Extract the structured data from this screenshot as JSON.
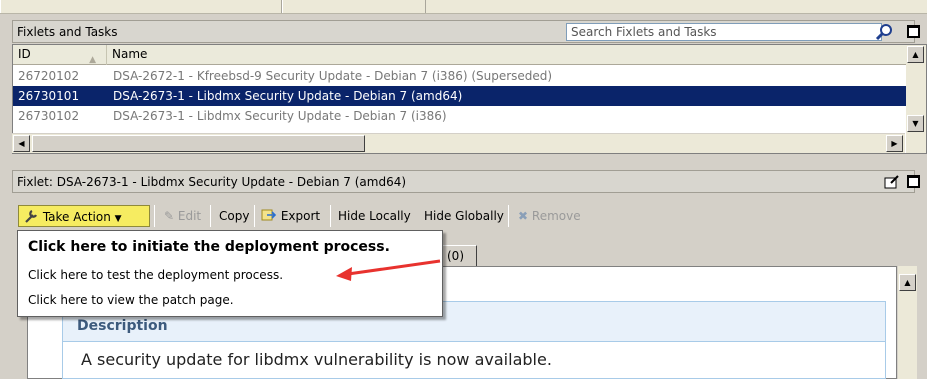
{
  "fixlets_panel": {
    "title": "Fixlets and Tasks",
    "search_placeholder": "Search Fixlets and Tasks",
    "columns": [
      "ID",
      "Name"
    ],
    "rows": [
      {
        "id": "26720102",
        "name": "DSA-2672-1 - Kfreebsd-9 Security Update - Debian 7 (i386) (Superseded)",
        "selected": false
      },
      {
        "id": "26730101",
        "name": "DSA-2673-1 - Libdmx Security Update - Debian 7 (amd64)",
        "selected": true
      },
      {
        "id": "26730102",
        "name": "DSA-2673-1 - Libdmx Security Update - Debian 7 (i386)",
        "selected": false
      }
    ]
  },
  "fixlet_detail": {
    "title": "Fixlet: DSA-2673-1 - Libdmx Security Update - Debian 7 (amd64)"
  },
  "toolbar": {
    "take_action": "Take Action",
    "edit": "Edit",
    "copy": "Copy",
    "export": "Export",
    "hide_locally": "Hide Locally",
    "hide_globally": "Hide Globally",
    "remove": "Remove"
  },
  "take_action_menu": {
    "items": [
      "Click here to initiate the deployment process.",
      "Click here to test the deployment process.",
      "Click here to view the patch page."
    ]
  },
  "tab_count": "(0)",
  "description": {
    "title": "Description",
    "text": "A security update for libdmx vulnerability is now available."
  },
  "colors": {
    "selection": "#0a246a",
    "take_action_highlight": "#f6ec61",
    "annotation_arrow": "#e8322e",
    "description_header": "#e8f1fa"
  }
}
